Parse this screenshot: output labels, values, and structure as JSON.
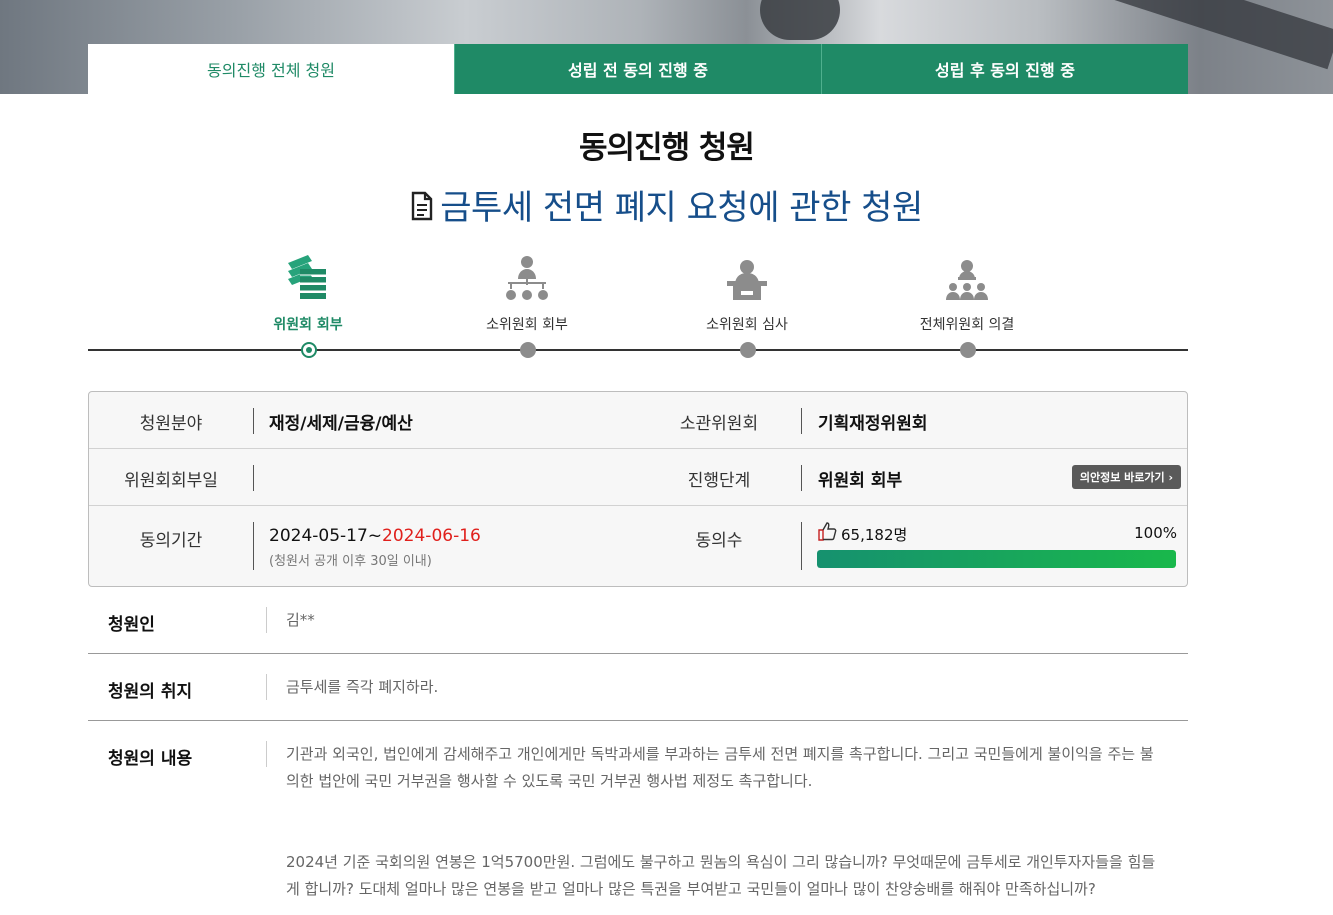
{
  "tabs": [
    {
      "label": "동의진행 전체 청원",
      "active": true
    },
    {
      "label": "성립 전 동의 진행 중",
      "active": false
    },
    {
      "label": "성립 후 동의 진행 중",
      "active": false
    }
  ],
  "page_title": "동의진행 청원",
  "petition_title": "금투세 전면 폐지 요청에 관한 청원",
  "steps": [
    {
      "label": "위원회 회부",
      "icon": "papers-stack-icon",
      "active": true
    },
    {
      "label": "소위원회 회부",
      "icon": "org-chart-icon",
      "active": false
    },
    {
      "label": "소위원회 심사",
      "icon": "podium-speaker-icon",
      "active": false
    },
    {
      "label": "전체위원회 의결",
      "icon": "assembly-icon",
      "active": false
    }
  ],
  "info": {
    "field_label": "청원분야",
    "field_value": "재정/세제/금융/예산",
    "committee_label": "소관위원회",
    "committee_value": "기획재정위원회",
    "referral_date_label": "위원회회부일",
    "referral_date_value": "",
    "stage_label": "진행단계",
    "stage_value": "위원회 회부",
    "bill_button": "의안정보 바로가기 ›",
    "period_label": "동의기간",
    "period_start": "2024-05-17~",
    "period_end": "2024-06-16",
    "period_note": "(청원서 공개 이후 30일 이내)",
    "agree_label": "동의수",
    "agree_count": "65,182명",
    "agree_percent_text": "100%",
    "agree_percent": 100,
    "colors": {
      "accent": "#1f8a66",
      "end_date": "#e0201c",
      "title": "#164e8a"
    }
  },
  "details": {
    "petitioner_label": "청원인",
    "petitioner_value": "김**",
    "purpose_label": "청원의 취지",
    "purpose_value": "금투세를 즉각 폐지하라.",
    "content_label": "청원의 내용",
    "content_p1": "기관과 외국인, 법인에게 감세해주고 개인에게만 독박과세를 부과하는 금투세 전면 폐지를 촉구합니다. 그리고 국민들에게 불이익을 주는 불의한 법안에 국민 거부권을 행사할 수 있도록 국민 거부권 행사법 제정도 촉구합니다.",
    "content_p2": "2024년 기준 국회의원 연봉은 1억5700만원. 그럼에도 불구하고 뭔놈의 욕심이 그리 많습니까? 무엇때문에 금투세로 개인투자자들을 힘들게 합니까? 도대체 얼마나 많은 연봉을 받고 얼마나 많은 특권을 부여받고 국민들이 얼마나 많이 찬양숭배를 해줘야 만족하십니까?"
  }
}
